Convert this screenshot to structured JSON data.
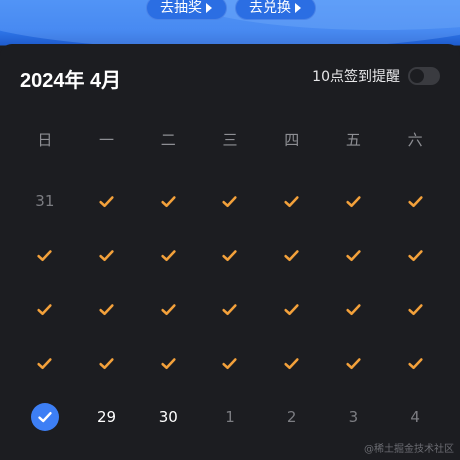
{
  "top_actions": {
    "lottery_label": "去抽奖",
    "exchange_label": "去兑换"
  },
  "header": {
    "month_title": "2024年 4月",
    "reminder_label": "10点签到提醒",
    "reminder_enabled": false
  },
  "weekdays": [
    "日",
    "一",
    "二",
    "三",
    "四",
    "五",
    "六"
  ],
  "days": [
    {
      "label": "31",
      "state": "other-month"
    },
    {
      "label": "",
      "state": "checked"
    },
    {
      "label": "",
      "state": "checked"
    },
    {
      "label": "",
      "state": "checked"
    },
    {
      "label": "",
      "state": "checked"
    },
    {
      "label": "",
      "state": "checked"
    },
    {
      "label": "",
      "state": "checked"
    },
    {
      "label": "",
      "state": "checked"
    },
    {
      "label": "",
      "state": "checked"
    },
    {
      "label": "",
      "state": "checked"
    },
    {
      "label": "",
      "state": "checked"
    },
    {
      "label": "",
      "state": "checked"
    },
    {
      "label": "",
      "state": "checked"
    },
    {
      "label": "",
      "state": "checked"
    },
    {
      "label": "",
      "state": "checked"
    },
    {
      "label": "",
      "state": "checked"
    },
    {
      "label": "",
      "state": "checked"
    },
    {
      "label": "",
      "state": "checked"
    },
    {
      "label": "",
      "state": "checked"
    },
    {
      "label": "",
      "state": "checked"
    },
    {
      "label": "",
      "state": "checked"
    },
    {
      "label": "",
      "state": "checked"
    },
    {
      "label": "",
      "state": "checked"
    },
    {
      "label": "",
      "state": "checked"
    },
    {
      "label": "",
      "state": "checked"
    },
    {
      "label": "",
      "state": "checked"
    },
    {
      "label": "",
      "state": "checked"
    },
    {
      "label": "",
      "state": "checked"
    },
    {
      "label": "",
      "state": "today-checked"
    },
    {
      "label": "29",
      "state": "upcoming"
    },
    {
      "label": "30",
      "state": "upcoming"
    },
    {
      "label": "1",
      "state": "other-month"
    },
    {
      "label": "2",
      "state": "other-month"
    },
    {
      "label": "3",
      "state": "other-month"
    },
    {
      "label": "4",
      "state": "other-month"
    }
  ],
  "colors": {
    "check": "#f3a13b",
    "today": "#3d7ff5",
    "panel": "#1c1d21"
  },
  "watermark": "@稀土掘金技术社区"
}
